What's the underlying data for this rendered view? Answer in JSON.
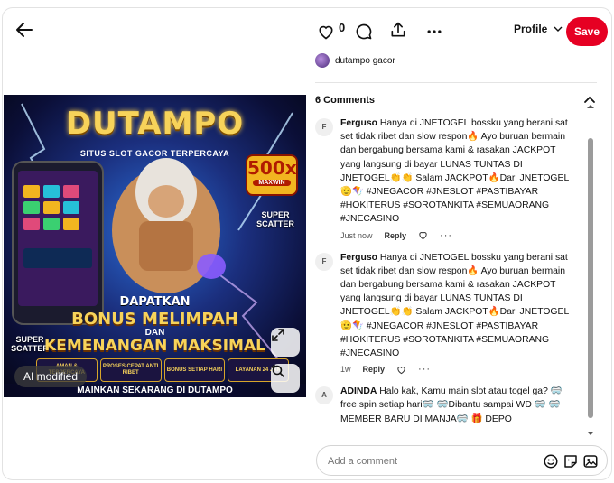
{
  "pin": {
    "ai_badge": "AI modified",
    "image_text": {
      "brand": "DUTAMPO",
      "tagline": "SITUS SLOT GACOR TERPERCAYA",
      "maxwin_value": "500x",
      "maxwin_label": "MAXWIN",
      "scatter_right": "SUPER SCATTER",
      "scatter_left": "SUPER SCATTER",
      "promo_line1": "DAPATKAN",
      "promo_line2": "BONUS MELIMPAH",
      "promo_line3": "DAN",
      "promo_line4": "KEMENANGAN MAKSIMAL",
      "features": [
        "AMAN & TERPERCAYA",
        "PROSES CEPAT ANTI RIBET",
        "BONUS SETIAP HARI",
        "LAYANAN 24 JAM"
      ],
      "bottom": "MAINKAN SEKARANG DI DUTAMPO"
    }
  },
  "topbar": {
    "like_count": "0",
    "profile_label": "Profile",
    "save_label": "Save"
  },
  "creator": {
    "name": "dutampo gacor"
  },
  "comments": {
    "header": "6 Comments",
    "items": [
      {
        "avatar": "F",
        "author": "Ferguso",
        "text": "Hanya di JNETOGEL bossku yang berani sat set tidak ribet dan slow respon🔥 Ayo buruan bermain dan bergabung bersama kami & rasakan JACKPOT yang langsung di bayar LUNAS TUNTAS DI JNETOGEL👏👏 Salam JACKPOT🔥Dari JNETOGEL🫡🪁 #JNEGACOR #JNESLOT #PASTIBAYAR #HOKITERUS #SOROTANKITA #SEMUAORANG #JNECASINO",
        "time": "Just now",
        "reply": "Reply"
      },
      {
        "avatar": "F",
        "author": "Ferguso",
        "text": "Hanya di JNETOGEL bossku yang berani sat set tidak ribet dan slow respon🔥 Ayo buruan bermain dan bergabung bersama kami & rasakan JACKPOT yang langsung di bayar LUNAS TUNTAS DI JNETOGEL👏👏 Salam JACKPOT🔥Dari JNETOGEL🫡🪁 #JNEGACOR #JNESLOT #PASTIBAYAR #HOKITERUS #SOROTANKITA #SEMUAORANG #JNECASINO",
        "time": "1w",
        "reply": "Reply"
      },
      {
        "avatar": "A",
        "author": "ADINDA",
        "text": "Halo kak, Kamu main slot atau togel ga? 🥽free spin setiap hari🥽 🥽Dibantu sampai WD 🥽 🥽MEMBER BARU DI MANJA🥽 🎁 DEPO",
        "time": "",
        "reply": ""
      }
    ]
  },
  "comment_input": {
    "placeholder": "Add a comment"
  },
  "colors": {
    "save": "#e60023",
    "text": "#111111"
  }
}
